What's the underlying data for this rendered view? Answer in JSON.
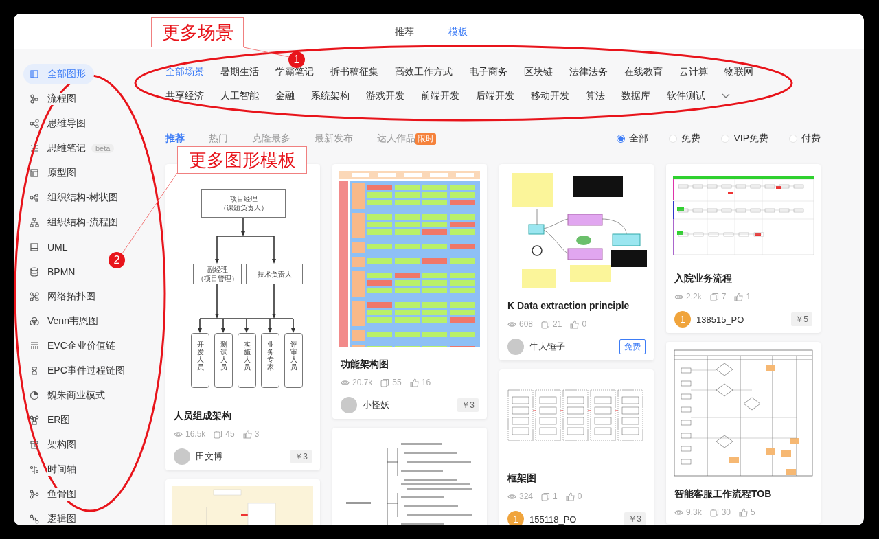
{
  "top_tabs": [
    {
      "label": "推荐",
      "selected": false
    },
    {
      "label": "模板",
      "selected": true
    }
  ],
  "sidebar": {
    "items": [
      {
        "label": "全部图形",
        "selected": true
      },
      {
        "label": "流程图",
        "selected": false
      },
      {
        "label": "思维导图",
        "selected": false
      },
      {
        "label": "思维笔记",
        "selected": false,
        "badge": "beta"
      },
      {
        "label": "原型图",
        "selected": false
      },
      {
        "label": "组织结构-树状图",
        "selected": false
      },
      {
        "label": "组织结构-流程图",
        "selected": false
      },
      {
        "label": "UML",
        "selected": false
      },
      {
        "label": "BPMN",
        "selected": false
      },
      {
        "label": "网络拓扑图",
        "selected": false
      },
      {
        "label": "Venn韦恩图",
        "selected": false
      },
      {
        "label": "EVC企业价值链",
        "selected": false
      },
      {
        "label": "EPC事件过程链图",
        "selected": false
      },
      {
        "label": "魏朱商业模式",
        "selected": false
      },
      {
        "label": "ER图",
        "selected": false
      },
      {
        "label": "架构图",
        "selected": false
      },
      {
        "label": "时间轴",
        "selected": false
      },
      {
        "label": "鱼骨图",
        "selected": false
      },
      {
        "label": "逻辑图",
        "selected": false
      }
    ]
  },
  "scenes": {
    "tags": [
      {
        "label": "全部场景",
        "selected": true
      },
      {
        "label": "暑期生活",
        "selected": false
      },
      {
        "label": "学霸笔记",
        "selected": false
      },
      {
        "label": "拆书稿征集",
        "selected": false
      },
      {
        "label": "高效工作方式",
        "selected": false
      },
      {
        "label": "电子商务",
        "selected": false
      },
      {
        "label": "区块链",
        "selected": false
      },
      {
        "label": "法律法务",
        "selected": false
      },
      {
        "label": "在线教育",
        "selected": false
      },
      {
        "label": "云计算",
        "selected": false
      },
      {
        "label": "物联网",
        "selected": false
      },
      {
        "label": "共享经济",
        "selected": false
      },
      {
        "label": "人工智能",
        "selected": false
      },
      {
        "label": "金融",
        "selected": false
      },
      {
        "label": "系统架构",
        "selected": false
      },
      {
        "label": "游戏开发",
        "selected": false
      },
      {
        "label": "前端开发",
        "selected": false
      },
      {
        "label": "后端开发",
        "selected": false
      },
      {
        "label": "移动开发",
        "selected": false
      },
      {
        "label": "算法",
        "selected": false
      },
      {
        "label": "数据库",
        "selected": false
      },
      {
        "label": "软件测试",
        "selected": false
      }
    ]
  },
  "filters": {
    "tabs": [
      {
        "label": "推荐",
        "selected": true
      },
      {
        "label": "热门",
        "selected": false
      },
      {
        "label": "克隆最多",
        "selected": false
      },
      {
        "label": "最新发布",
        "selected": false
      },
      {
        "label": "达人作品",
        "selected": false,
        "badge": "限时"
      }
    ],
    "price_options": [
      {
        "label": "全部",
        "selected": true
      },
      {
        "label": "免费",
        "selected": false
      },
      {
        "label": "VIP免费",
        "selected": false
      },
      {
        "label": "付费",
        "selected": false
      }
    ]
  },
  "card_columns": [
    {
      "cards": [
        {
          "thumbnail": {
            "kind": "org_chart",
            "top": [
              "项目经理",
              "（课题负责人）"
            ],
            "middle": [
              [
                "副经理",
                "（项目管理）"
              ],
              [
                "技术负责人"
              ]
            ],
            "bottom": [
              "开发人员",
              "测试人员",
              "实施人员",
              "业务专家",
              "评审人员"
            ]
          },
          "title": "人员组成架构",
          "views": "16.5k",
          "copies": "45",
          "likes": "3",
          "author": {
            "avatar": {
              "kind": "photo"
            },
            "name": "田文博"
          },
          "price": {
            "kind": "paid",
            "text": "￥3"
          }
        },
        {
          "thumbnail": {
            "kind": "yellow_map"
          }
        }
      ]
    },
    {
      "cards": [
        {
          "thumbnail": {
            "kind": "function_arch"
          },
          "title": "功能架构图",
          "views": "20.7k",
          "copies": "55",
          "likes": "16",
          "author": {
            "avatar": {
              "kind": "photo"
            },
            "name": "小怪妖"
          },
          "price": {
            "kind": "paid",
            "text": "￥3"
          }
        },
        {
          "thumbnail": {
            "kind": "mind_map"
          }
        }
      ]
    },
    {
      "cards": [
        {
          "thumbnail": {
            "kind": "data_flow"
          },
          "title": "K Data extraction principle",
          "views": "608",
          "copies": "21",
          "likes": "0",
          "author": {
            "avatar": {
              "kind": "photo"
            },
            "name": "牛大锤子"
          },
          "price": {
            "kind": "free",
            "text": "免费"
          }
        },
        {
          "thumbnail": {
            "kind": "framework"
          },
          "title": "框架图",
          "views": "324",
          "copies": "1",
          "likes": "0",
          "author": {
            "avatar": {
              "kind": "letter",
              "text": "1"
            },
            "name": "155118_PO"
          },
          "price": {
            "kind": "paid",
            "text": "￥3"
          }
        }
      ]
    },
    {
      "cards": [
        {
          "thumbnail": {
            "kind": "hospital_flow"
          },
          "title": "入院业务流程",
          "views": "2.2k",
          "copies": "7",
          "likes": "1",
          "author": {
            "avatar": {
              "kind": "letter",
              "text": "1"
            },
            "name": "138515_PO"
          },
          "price": {
            "kind": "paid",
            "text": "￥5"
          }
        },
        {
          "thumbnail": {
            "kind": "swimlane"
          },
          "title": "智能客服工作流程TOB",
          "views": "9.3k",
          "copies": "30",
          "likes": "5"
        }
      ]
    }
  ],
  "annotations": [
    {
      "number": "1",
      "label": "更多场景"
    },
    {
      "number": "2",
      "label": "更多图形模板"
    }
  ]
}
